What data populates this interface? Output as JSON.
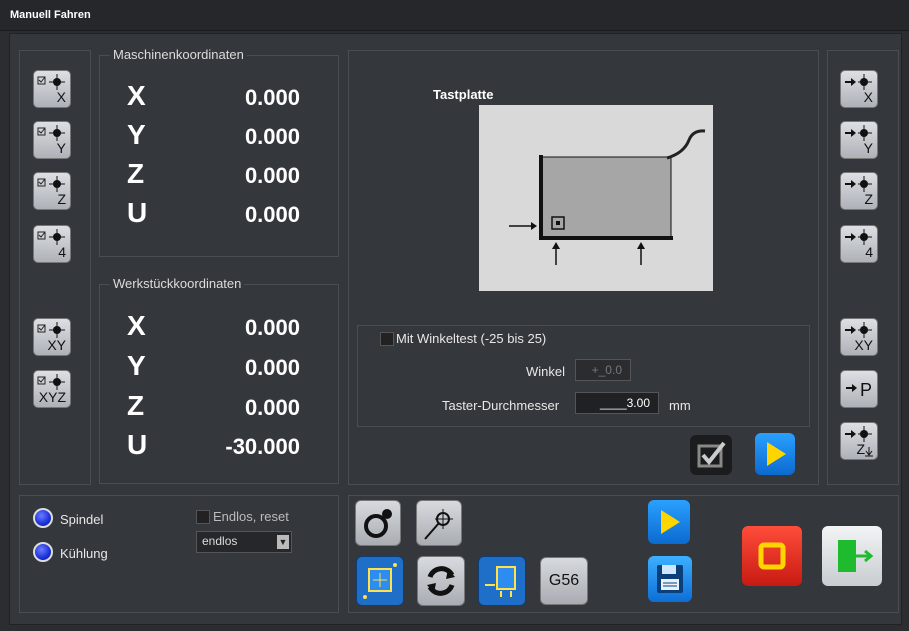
{
  "window": {
    "title": "Manuell Fahren"
  },
  "machine_coords": {
    "title": "Maschinenkoordinaten",
    "axes": [
      {
        "axis": "X",
        "value": "0.000"
      },
      {
        "axis": "Y",
        "value": "0.000"
      },
      {
        "axis": "Z",
        "value": "0.000"
      },
      {
        "axis": "U",
        "value": "0.000"
      }
    ]
  },
  "work_coords": {
    "title": "Werkstückkoordinaten",
    "axes": [
      {
        "axis": "X",
        "value": "0.000"
      },
      {
        "axis": "Y",
        "value": "0.000"
      },
      {
        "axis": "Z",
        "value": "0.000"
      },
      {
        "axis": "U",
        "value": "-30.000"
      }
    ]
  },
  "left_buttons": [
    "X",
    "Y",
    "Z",
    "4",
    "XY",
    "XYZ"
  ],
  "right_buttons": [
    "X",
    "Y",
    "Z",
    "4",
    "XY",
    "P",
    "Z"
  ],
  "probe": {
    "title": "Tastplatte",
    "angle_test_label": "Mit Winkeltest (-25 bis 25)",
    "angle_label": "Winkel",
    "angle_value": "+_0.0",
    "diameter_label": "Taster-Durchmesser",
    "diameter_value": "____3.00",
    "diameter_unit": "mm"
  },
  "bottom_left": {
    "spindle_label": "Spindel",
    "cooling_label": "Kühlung",
    "endless_reset_label": "Endlos, reset",
    "mode_select": "endlos"
  },
  "bottom_mid": {
    "g56_label": "G56"
  },
  "icons": {
    "play": "play-icon",
    "save": "save-icon",
    "stop": "stop-icon",
    "exit": "exit-icon",
    "refresh": "refresh-icon",
    "check": "checkmark-icon"
  }
}
